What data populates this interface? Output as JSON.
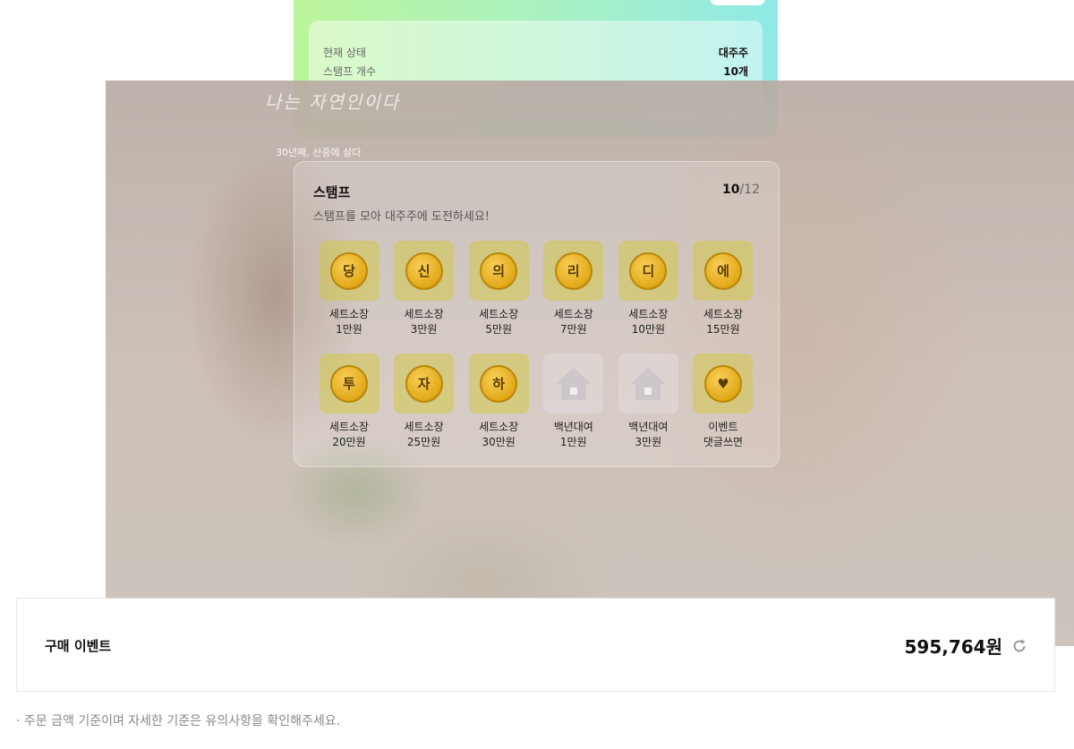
{
  "status": {
    "rows": [
      {
        "label": "현재 상태",
        "value": "대주주"
      },
      {
        "label": "스탬프 개수",
        "value": "10개"
      }
    ]
  },
  "photo": {
    "caption_main": "나는 자연인이다",
    "caption_sub": "30년째, 산중에 살다"
  },
  "stamp": {
    "title": "스탬프",
    "count_current": "10",
    "count_total": "/12",
    "subtitle": "스탬프를 모아 대주주에 도전하세요!",
    "items": [
      {
        "glyph": "당",
        "line1": "세트소장",
        "line2": "1만원",
        "kind": "coin"
      },
      {
        "glyph": "신",
        "line1": "세트소장",
        "line2": "3만원",
        "kind": "coin"
      },
      {
        "glyph": "의",
        "line1": "세트소장",
        "line2": "5만원",
        "kind": "coin"
      },
      {
        "glyph": "리",
        "line1": "세트소장",
        "line2": "7만원",
        "kind": "coin"
      },
      {
        "glyph": "디",
        "line1": "세트소장",
        "line2": "10만원",
        "kind": "coin"
      },
      {
        "glyph": "에",
        "line1": "세트소장",
        "line2": "15만원",
        "kind": "coin"
      },
      {
        "glyph": "투",
        "line1": "세트소장",
        "line2": "20만원",
        "kind": "coin"
      },
      {
        "glyph": "자",
        "line1": "세트소장",
        "line2": "25만원",
        "kind": "coin"
      },
      {
        "glyph": "하",
        "line1": "세트소장",
        "line2": "30만원",
        "kind": "coin"
      },
      {
        "glyph": "",
        "line1": "백년대여",
        "line2": "1만원",
        "kind": "house"
      },
      {
        "glyph": "",
        "line1": "백년대여",
        "line2": "3만원",
        "kind": "house"
      },
      {
        "glyph": "♥",
        "line1": "이벤트",
        "line2": "댓글쓰면",
        "kind": "coin"
      }
    ]
  },
  "purchase": {
    "title": "구매 이벤트",
    "amount": "595,764원"
  },
  "note": "· 주문 금액 기준이며 자세한 기준은 유의사항을 확인해주세요.",
  "colors": {
    "gradient_start": "#bdf59a",
    "gradient_end": "#8fe9e6",
    "coin": "#e2a818"
  }
}
